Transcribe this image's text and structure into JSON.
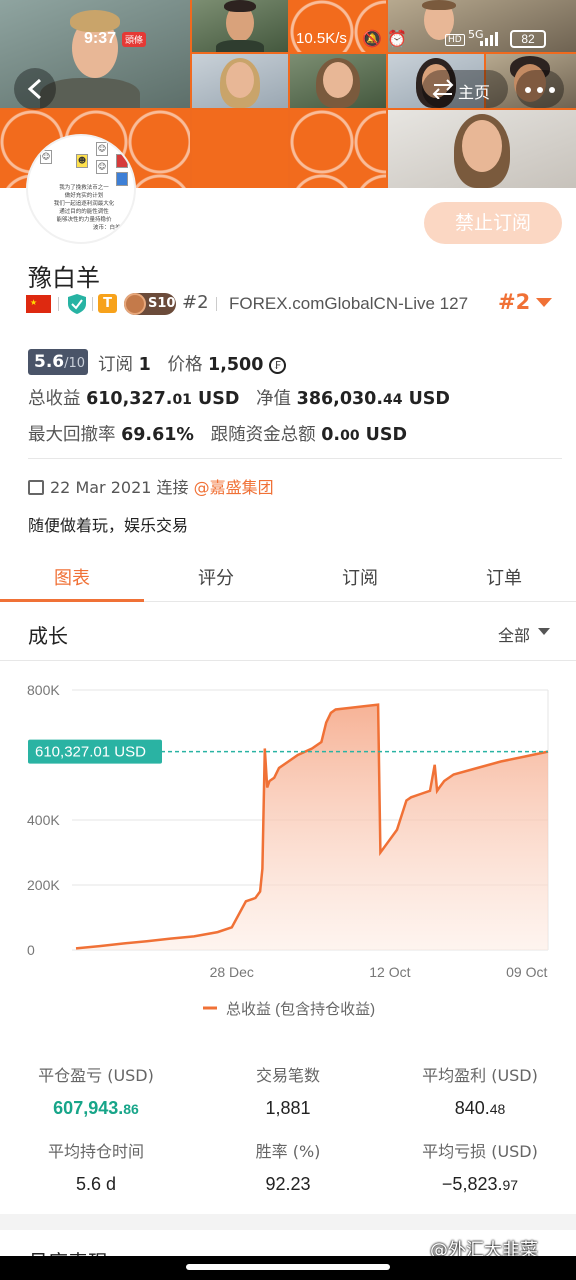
{
  "status_bar": {
    "time": "9:37",
    "badge": "頭條",
    "speed": "10.5K/s",
    "network": "5G",
    "battery": "82"
  },
  "header": {
    "home_label": "主页",
    "subscribe_button": "禁止订阅"
  },
  "avatar": {
    "caption_lines": [
      "我为了挽救法币之一",
      "做好充实的计划",
      "我们一起追逐利润最大化",
      "通过目的的能性调性",
      "能够决性的力量持稳价"
    ],
    "source": "波币：白羊座"
  },
  "profile": {
    "name": "豫白羊",
    "level_badge": "S10",
    "rank_small": "#2",
    "broker": "FOREX.comGlobalCN-Live 127",
    "rank_big": "#2"
  },
  "stats": {
    "score": "5.6",
    "score_max": "/10",
    "subscriptions_label": "订阅",
    "subscriptions_value": "1",
    "price_label": "价格",
    "price_value": "1,500",
    "price_currency_symbol": "₣",
    "total_return_label": "总收益",
    "total_return_int": "610,327.",
    "total_return_dec": "01",
    "total_return_unit": "USD",
    "equity_label": "净值",
    "equity_int": "386,030.",
    "equity_dec": "44",
    "equity_unit": "USD",
    "max_drawdown_label": "最大回撤率",
    "max_drawdown_value": "69.61%",
    "follower_funds_label": "跟随资金总额",
    "follower_funds_int": "0.",
    "follower_funds_dec": "00",
    "follower_funds_unit": "USD"
  },
  "meta": {
    "date": "22 Mar 2021",
    "connected_label": "连接",
    "org": "@嘉盛集团",
    "bio": "随便做着玩，娱乐交易"
  },
  "tabs": [
    {
      "label": "图表",
      "active": true
    },
    {
      "label": "评分",
      "active": false
    },
    {
      "label": "订阅",
      "active": false
    },
    {
      "label": "订单",
      "active": false
    }
  ],
  "growth": {
    "title": "成长",
    "filter": "全部"
  },
  "chart_data": {
    "type": "area",
    "title": "",
    "xlabel": "",
    "ylabel": "",
    "y_ticks": [
      "800K",
      "400K",
      "200K",
      "0"
    ],
    "x_ticks": [
      "28 Dec",
      "12 Oct",
      "09 Oct"
    ],
    "ylim": [
      0,
      800000
    ],
    "current_value_label": "610,327.01 USD",
    "current_value": 610327.01,
    "series": [
      {
        "name": "总收益 (包含持仓收益)",
        "color": "#f07136",
        "x": [
          0,
          0.05,
          0.1,
          0.15,
          0.2,
          0.25,
          0.3,
          0.33,
          0.36,
          0.38,
          0.39,
          0.395,
          0.4,
          0.405,
          0.41,
          0.42,
          0.43,
          0.45,
          0.47,
          0.5,
          0.52,
          0.53,
          0.54,
          0.55,
          0.58,
          0.61,
          0.64,
          0.645,
          0.65,
          0.66,
          0.68,
          0.7,
          0.71,
          0.73,
          0.75,
          0.76,
          0.765,
          0.77,
          0.78,
          0.8,
          0.85,
          0.9,
          0.95,
          1.0
        ],
        "values": [
          5000,
          12000,
          20000,
          27000,
          35000,
          42000,
          55000,
          70000,
          150000,
          160000,
          180000,
          250000,
          620000,
          500000,
          520000,
          530000,
          560000,
          580000,
          600000,
          620000,
          640000,
          700000,
          730000,
          740000,
          745000,
          750000,
          755000,
          300000,
          310000,
          330000,
          370000,
          460000,
          470000,
          480000,
          490000,
          570000,
          490000,
          500000,
          520000,
          540000,
          560000,
          580000,
          595000,
          610327
        ]
      }
    ],
    "legend": "bottom-center",
    "grid": true
  },
  "kpis": [
    {
      "label": "平仓盈亏 (USD)",
      "int": "607,943.",
      "dec": "86",
      "green": true
    },
    {
      "label": "交易笔数",
      "int": "1,881",
      "dec": "",
      "green": false
    },
    {
      "label": "平均盈利 (USD)",
      "int": "840.",
      "dec": "48",
      "green": false
    },
    {
      "label": "平均持仓时间",
      "int": "5.6 d",
      "dec": "",
      "green": false
    },
    {
      "label": "胜率 (%)",
      "int": "92.23",
      "dec": "",
      "green": false
    },
    {
      "label": "平均亏损 (USD)",
      "int": "−5,823.",
      "dec": "97",
      "green": false
    }
  ],
  "next_section_title": "月度表现",
  "watermark": "@外汇大韭菜"
}
